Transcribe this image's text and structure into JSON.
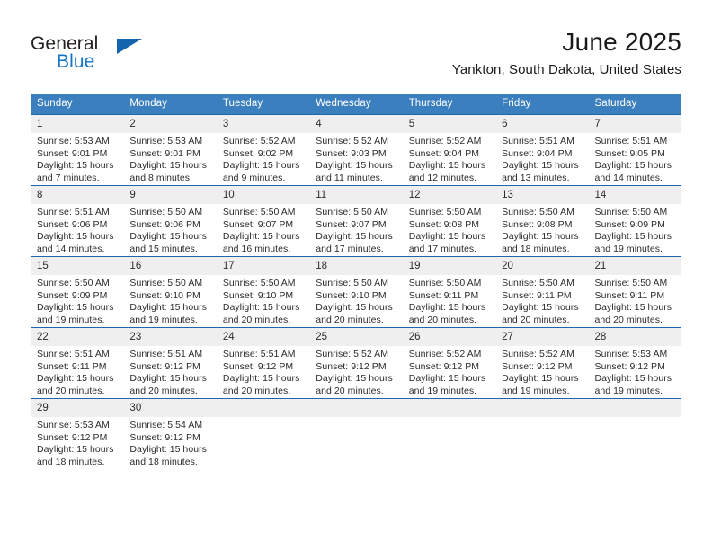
{
  "brand": {
    "name_part1": "General",
    "name_part2": "Blue",
    "logo_icon": "triangle-logo-icon",
    "accent_color": "#1373c4"
  },
  "header": {
    "title": "June 2025",
    "subtitle": "Yankton, South Dakota, United States"
  },
  "theme": {
    "header_bg": "#3c7fbe",
    "row_rule": "#1f66a8",
    "daynum_bg": "#efefef",
    "text": "#2b2b2b"
  },
  "calendar": {
    "weekday_headers": [
      "Sunday",
      "Monday",
      "Tuesday",
      "Wednesday",
      "Thursday",
      "Friday",
      "Saturday"
    ],
    "labels": {
      "sunrise": "Sunrise:",
      "sunset": "Sunset:",
      "daylight": "Daylight:"
    },
    "weeks": [
      [
        {
          "day": "1",
          "sunrise": "Sunrise: 5:53 AM",
          "sunset": "Sunset: 9:01 PM",
          "daylight_1": "Daylight: 15 hours",
          "daylight_2": "and 7 minutes."
        },
        {
          "day": "2",
          "sunrise": "Sunrise: 5:53 AM",
          "sunset": "Sunset: 9:01 PM",
          "daylight_1": "Daylight: 15 hours",
          "daylight_2": "and 8 minutes."
        },
        {
          "day": "3",
          "sunrise": "Sunrise: 5:52 AM",
          "sunset": "Sunset: 9:02 PM",
          "daylight_1": "Daylight: 15 hours",
          "daylight_2": "and 9 minutes."
        },
        {
          "day": "4",
          "sunrise": "Sunrise: 5:52 AM",
          "sunset": "Sunset: 9:03 PM",
          "daylight_1": "Daylight: 15 hours",
          "daylight_2": "and 11 minutes."
        },
        {
          "day": "5",
          "sunrise": "Sunrise: 5:52 AM",
          "sunset": "Sunset: 9:04 PM",
          "daylight_1": "Daylight: 15 hours",
          "daylight_2": "and 12 minutes."
        },
        {
          "day": "6",
          "sunrise": "Sunrise: 5:51 AM",
          "sunset": "Sunset: 9:04 PM",
          "daylight_1": "Daylight: 15 hours",
          "daylight_2": "and 13 minutes."
        },
        {
          "day": "7",
          "sunrise": "Sunrise: 5:51 AM",
          "sunset": "Sunset: 9:05 PM",
          "daylight_1": "Daylight: 15 hours",
          "daylight_2": "and 14 minutes."
        }
      ],
      [
        {
          "day": "8",
          "sunrise": "Sunrise: 5:51 AM",
          "sunset": "Sunset: 9:06 PM",
          "daylight_1": "Daylight: 15 hours",
          "daylight_2": "and 14 minutes."
        },
        {
          "day": "9",
          "sunrise": "Sunrise: 5:50 AM",
          "sunset": "Sunset: 9:06 PM",
          "daylight_1": "Daylight: 15 hours",
          "daylight_2": "and 15 minutes."
        },
        {
          "day": "10",
          "sunrise": "Sunrise: 5:50 AM",
          "sunset": "Sunset: 9:07 PM",
          "daylight_1": "Daylight: 15 hours",
          "daylight_2": "and 16 minutes."
        },
        {
          "day": "11",
          "sunrise": "Sunrise: 5:50 AM",
          "sunset": "Sunset: 9:07 PM",
          "daylight_1": "Daylight: 15 hours",
          "daylight_2": "and 17 minutes."
        },
        {
          "day": "12",
          "sunrise": "Sunrise: 5:50 AM",
          "sunset": "Sunset: 9:08 PM",
          "daylight_1": "Daylight: 15 hours",
          "daylight_2": "and 17 minutes."
        },
        {
          "day": "13",
          "sunrise": "Sunrise: 5:50 AM",
          "sunset": "Sunset: 9:08 PM",
          "daylight_1": "Daylight: 15 hours",
          "daylight_2": "and 18 minutes."
        },
        {
          "day": "14",
          "sunrise": "Sunrise: 5:50 AM",
          "sunset": "Sunset: 9:09 PM",
          "daylight_1": "Daylight: 15 hours",
          "daylight_2": "and 19 minutes."
        }
      ],
      [
        {
          "day": "15",
          "sunrise": "Sunrise: 5:50 AM",
          "sunset": "Sunset: 9:09 PM",
          "daylight_1": "Daylight: 15 hours",
          "daylight_2": "and 19 minutes."
        },
        {
          "day": "16",
          "sunrise": "Sunrise: 5:50 AM",
          "sunset": "Sunset: 9:10 PM",
          "daylight_1": "Daylight: 15 hours",
          "daylight_2": "and 19 minutes."
        },
        {
          "day": "17",
          "sunrise": "Sunrise: 5:50 AM",
          "sunset": "Sunset: 9:10 PM",
          "daylight_1": "Daylight: 15 hours",
          "daylight_2": "and 20 minutes."
        },
        {
          "day": "18",
          "sunrise": "Sunrise: 5:50 AM",
          "sunset": "Sunset: 9:10 PM",
          "daylight_1": "Daylight: 15 hours",
          "daylight_2": "and 20 minutes."
        },
        {
          "day": "19",
          "sunrise": "Sunrise: 5:50 AM",
          "sunset": "Sunset: 9:11 PM",
          "daylight_1": "Daylight: 15 hours",
          "daylight_2": "and 20 minutes."
        },
        {
          "day": "20",
          "sunrise": "Sunrise: 5:50 AM",
          "sunset": "Sunset: 9:11 PM",
          "daylight_1": "Daylight: 15 hours",
          "daylight_2": "and 20 minutes."
        },
        {
          "day": "21",
          "sunrise": "Sunrise: 5:50 AM",
          "sunset": "Sunset: 9:11 PM",
          "daylight_1": "Daylight: 15 hours",
          "daylight_2": "and 20 minutes."
        }
      ],
      [
        {
          "day": "22",
          "sunrise": "Sunrise: 5:51 AM",
          "sunset": "Sunset: 9:11 PM",
          "daylight_1": "Daylight: 15 hours",
          "daylight_2": "and 20 minutes."
        },
        {
          "day": "23",
          "sunrise": "Sunrise: 5:51 AM",
          "sunset": "Sunset: 9:12 PM",
          "daylight_1": "Daylight: 15 hours",
          "daylight_2": "and 20 minutes."
        },
        {
          "day": "24",
          "sunrise": "Sunrise: 5:51 AM",
          "sunset": "Sunset: 9:12 PM",
          "daylight_1": "Daylight: 15 hours",
          "daylight_2": "and 20 minutes."
        },
        {
          "day": "25",
          "sunrise": "Sunrise: 5:52 AM",
          "sunset": "Sunset: 9:12 PM",
          "daylight_1": "Daylight: 15 hours",
          "daylight_2": "and 20 minutes."
        },
        {
          "day": "26",
          "sunrise": "Sunrise: 5:52 AM",
          "sunset": "Sunset: 9:12 PM",
          "daylight_1": "Daylight: 15 hours",
          "daylight_2": "and 19 minutes."
        },
        {
          "day": "27",
          "sunrise": "Sunrise: 5:52 AM",
          "sunset": "Sunset: 9:12 PM",
          "daylight_1": "Daylight: 15 hours",
          "daylight_2": "and 19 minutes."
        },
        {
          "day": "28",
          "sunrise": "Sunrise: 5:53 AM",
          "sunset": "Sunset: 9:12 PM",
          "daylight_1": "Daylight: 15 hours",
          "daylight_2": "and 19 minutes."
        }
      ],
      [
        {
          "day": "29",
          "sunrise": "Sunrise: 5:53 AM",
          "sunset": "Sunset: 9:12 PM",
          "daylight_1": "Daylight: 15 hours",
          "daylight_2": "and 18 minutes."
        },
        {
          "day": "30",
          "sunrise": "Sunrise: 5:54 AM",
          "sunset": "Sunset: 9:12 PM",
          "daylight_1": "Daylight: 15 hours",
          "daylight_2": "and 18 minutes."
        },
        {
          "day": "",
          "sunrise": "",
          "sunset": "",
          "daylight_1": "",
          "daylight_2": ""
        },
        {
          "day": "",
          "sunrise": "",
          "sunset": "",
          "daylight_1": "",
          "daylight_2": ""
        },
        {
          "day": "",
          "sunrise": "",
          "sunset": "",
          "daylight_1": "",
          "daylight_2": ""
        },
        {
          "day": "",
          "sunrise": "",
          "sunset": "",
          "daylight_1": "",
          "daylight_2": ""
        },
        {
          "day": "",
          "sunrise": "",
          "sunset": "",
          "daylight_1": "",
          "daylight_2": ""
        }
      ]
    ]
  }
}
